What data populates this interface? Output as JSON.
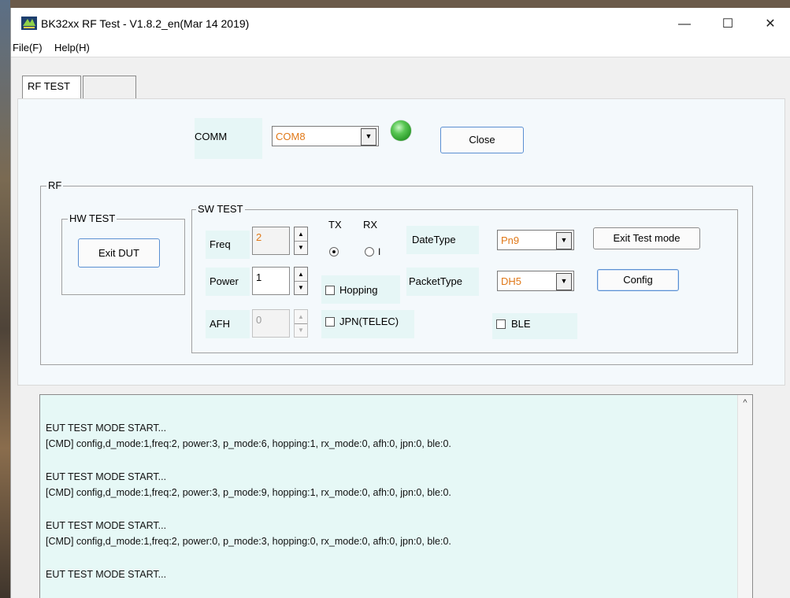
{
  "window": {
    "title": "BK32xx RF Test - V1.8.2_en(Mar 14 2019)",
    "controls": {
      "minimize": "—",
      "maximize": "☐",
      "close": "✕"
    }
  },
  "menu": {
    "file": "File(F)",
    "help": "Help(H)"
  },
  "tabs": [
    {
      "label": "RF TEST"
    },
    {
      "label": ""
    }
  ],
  "comm": {
    "label": "COMM",
    "port": "COM8",
    "close_button": "Close",
    "status_color": "#3cb83a"
  },
  "rf": {
    "group_label": "RF",
    "hw_test": {
      "group_label": "HW TEST",
      "exit_dut": "Exit DUT"
    },
    "sw_test": {
      "group_label": "SW TEST",
      "freq_label": "Freq",
      "freq_value": "2",
      "power_label": "Power",
      "power_value": "1",
      "afh_label": "AFH",
      "afh_value": "0",
      "tx_label": "TX",
      "rx_label": "RX",
      "rx_radio_text": "I",
      "tx_selected": true,
      "hopping_label": "Hopping",
      "jpn_label": "JPN(TELEC)",
      "datetype_label": "DateType",
      "datetype_value": "Pn9",
      "packettype_label": "PacketType",
      "packettype_value": "DH5",
      "ble_label": "BLE",
      "exit_test_mode": "Exit Test mode",
      "config": "Config"
    }
  },
  "log": {
    "lines": [
      "EUT TEST MODE START...",
      "[CMD] config,d_mode:1,freq:2, power:3, p_mode:6, hopping:1, rx_mode:0, afh:0, jpn:0, ble:0.",
      "EUT TEST MODE START...",
      "[CMD] config,d_mode:1,freq:2, power:3, p_mode:9, hopping:1, rx_mode:0, afh:0, jpn:0, ble:0.",
      "EUT TEST MODE START...",
      "[CMD] config,d_mode:1,freq:2, power:0, p_mode:3, hopping:0, rx_mode:0, afh:0, jpn:0, ble:0.",
      "EUT TEST MODE START..."
    ],
    "scroll_up": "^"
  }
}
